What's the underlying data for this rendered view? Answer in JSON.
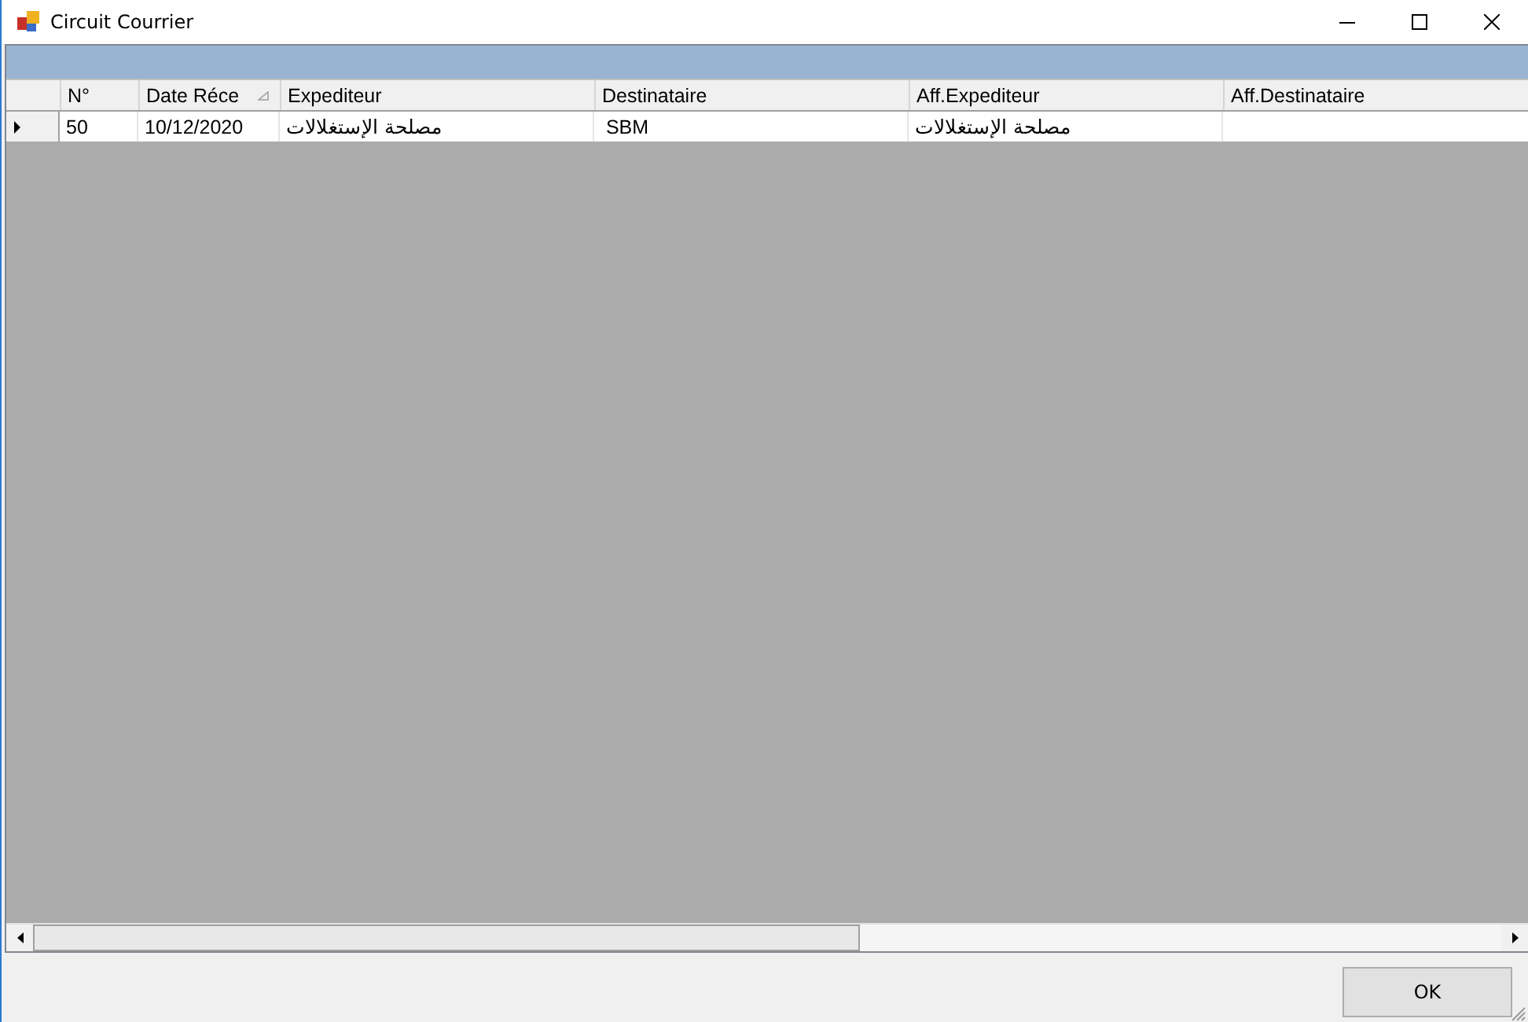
{
  "window": {
    "title": "Circuit Courrier"
  },
  "table": {
    "columns": [
      {
        "label": "N°",
        "sorted": false
      },
      {
        "label": "Date Réce",
        "sorted": true
      },
      {
        "label": "Expediteur",
        "sorted": false
      },
      {
        "label": "Destinataire",
        "sorted": false
      },
      {
        "label": "Aff.Expediteur",
        "sorted": false
      },
      {
        "label": "Aff.Destinataire",
        "sorted": false
      }
    ],
    "rows": [
      {
        "current": true,
        "cells": [
          "50",
          "10/12/2020",
          "مصلحة الإستغلالات",
          " SBM",
          "مصلحة الإستغلالات",
          ""
        ]
      }
    ]
  },
  "buttons": [
    {
      "label": "OK"
    }
  ]
}
